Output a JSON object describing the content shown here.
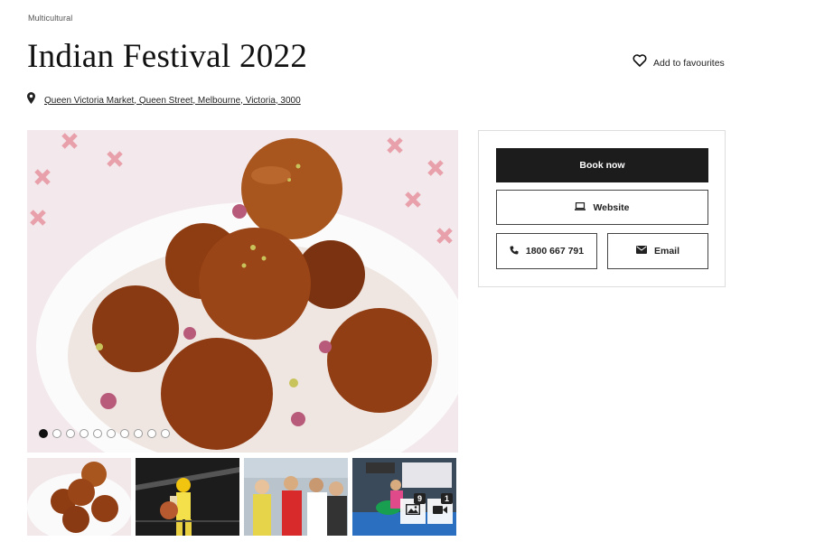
{
  "event": {
    "category": "Multicultural",
    "title": "Indian Festival 2022",
    "favourite_label": "Add to favourites",
    "address": "Queen Victoria Market, Queen Street, Melbourne, Victoria, 3000"
  },
  "actions": {
    "book_label": "Book now",
    "website_label": "Website",
    "phone_label": "1800 667 791",
    "email_label": "Email"
  },
  "gallery": {
    "main_image": "gulab-jamun-dessert-photo",
    "slide_count": 10,
    "active_slide": 1,
    "thumbnails": [
      "gulab-jamun-photo",
      "bhangra-dancer-photo",
      "festival-crowd-photo",
      "stage-dancer-photo"
    ],
    "photo_count": "9",
    "video_count": "1"
  }
}
